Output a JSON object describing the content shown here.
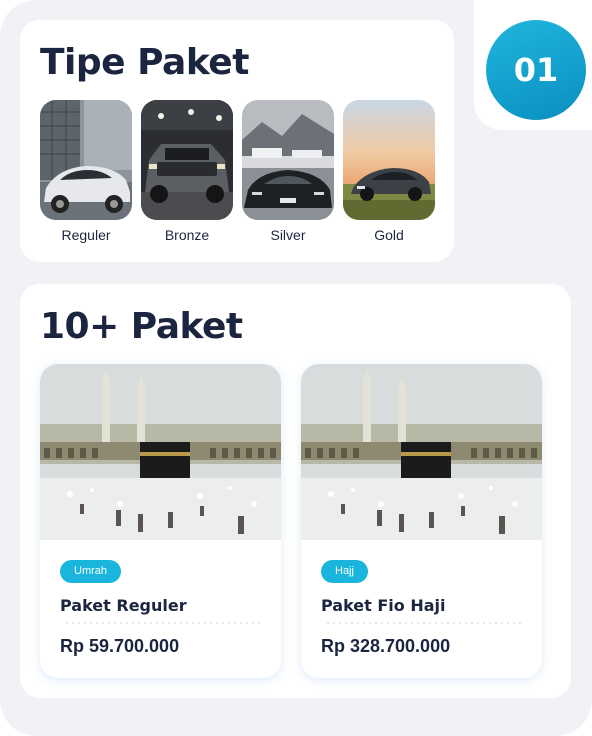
{
  "badge": {
    "number": "01"
  },
  "tipe_paket": {
    "title": "Tipe Paket",
    "items": [
      {
        "label": "Reguler"
      },
      {
        "label": "Bronze"
      },
      {
        "label": "Silver"
      },
      {
        "label": "Gold"
      }
    ]
  },
  "paket": {
    "title": "10+ Paket",
    "items": [
      {
        "tag": "Umrah",
        "name": "Paket Reguler",
        "price": "Rp 59.700.000"
      },
      {
        "tag": "Hajj",
        "name": "Paket Fio Haji",
        "price": "Rp 328.700.000"
      }
    ]
  },
  "colors": {
    "accent": "#19b5dd",
    "text": "#1c2540",
    "background": "#f0f2f6"
  }
}
